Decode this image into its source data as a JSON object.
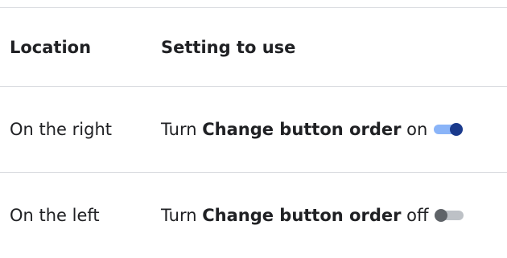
{
  "table": {
    "headers": {
      "location": "Location",
      "setting": "Setting to use"
    },
    "rows": [
      {
        "location": "On the right",
        "prefix": "Turn",
        "setting_name": "Change button order",
        "state": "on",
        "toggle_state": "on"
      },
      {
        "location": "On the left",
        "prefix": "Turn",
        "setting_name": "Change button order",
        "state": "off",
        "toggle_state": "off"
      }
    ]
  },
  "colors": {
    "toggle_on_track": "#8ab4f8",
    "toggle_on_knob": "#1a3a8c",
    "toggle_off_track": "#bdc1c6",
    "toggle_off_knob": "#5f6368",
    "divider": "#dadce0"
  }
}
